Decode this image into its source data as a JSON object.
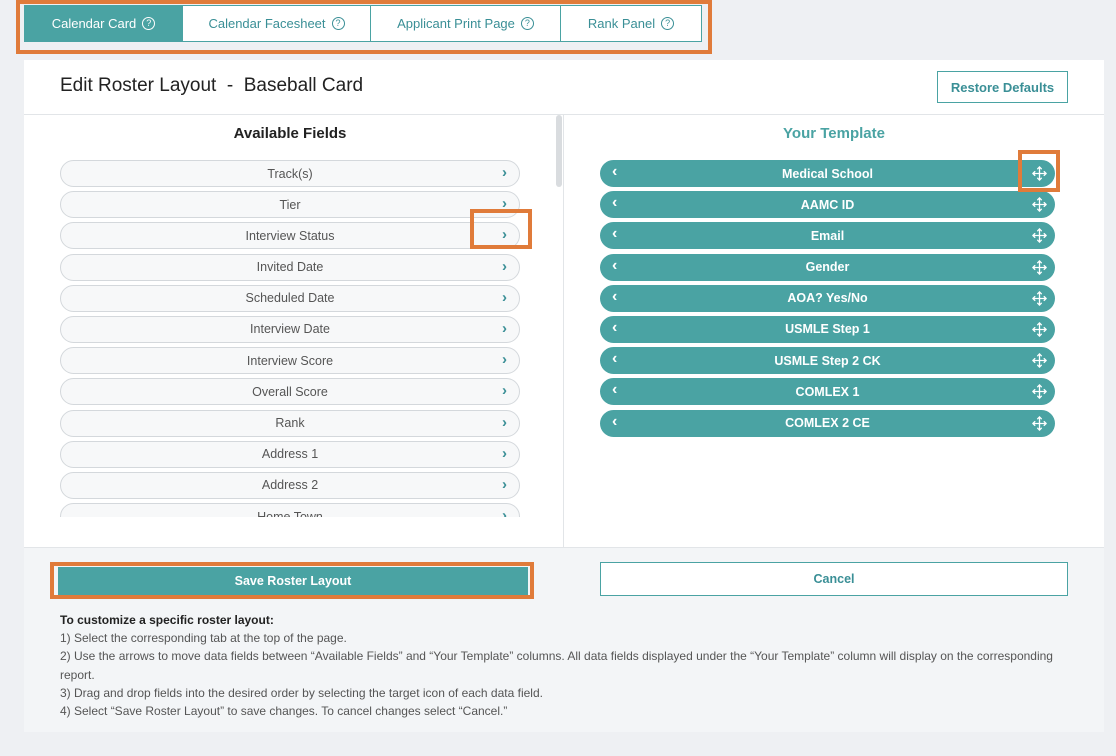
{
  "tabs": [
    {
      "label": "Calendar Card",
      "active": true
    },
    {
      "label": "Calendar Facesheet",
      "active": false
    },
    {
      "label": "Applicant Print Page",
      "active": false
    },
    {
      "label": "Rank Panel",
      "active": false
    }
  ],
  "help_glyph": "?",
  "header": {
    "title": "Edit Roster Layout  -  Baseball Card",
    "restore_label": "Restore Defaults"
  },
  "available": {
    "title": "Available Fields",
    "arrow_glyph": "›",
    "items": [
      "Track(s)",
      "Tier",
      "Interview Status",
      "Invited Date",
      "Scheduled Date",
      "Interview Date",
      "Interview Score",
      "Overall Score",
      "Rank",
      "Address 1",
      "Address 2",
      "Home Town"
    ]
  },
  "template": {
    "title": "Your Template",
    "arrow_glyph": "‹",
    "items": [
      "Medical School",
      "AAMC ID",
      "Email",
      "Gender",
      "AOA? Yes/No",
      "USMLE Step 1",
      "USMLE Step 2 CK",
      "COMLEX 1",
      "COMLEX 2 CE"
    ]
  },
  "footer": {
    "save_label": "Save Roster Layout",
    "cancel_label": "Cancel",
    "instructions_title": "To customize a specific roster layout:",
    "instructions": [
      "1) Select the corresponding tab at the top of the page.",
      "2) Use the arrows to move data fields between “Available Fields” and “Your Template” columns. All data fields displayed under the “Your Template” column will display on the corresponding report.",
      "3) Drag and drop fields into the desired order by selecting the target icon of each data field.",
      "4) Select “Save Roster Layout” to save changes. To cancel changes select “Cancel.”"
    ]
  },
  "colors": {
    "accent": "#4aa3a3",
    "highlight": "#e07b3a"
  },
  "icons": [
    "help-icon",
    "chevron-right-icon",
    "chevron-left-icon",
    "move-icon"
  ]
}
